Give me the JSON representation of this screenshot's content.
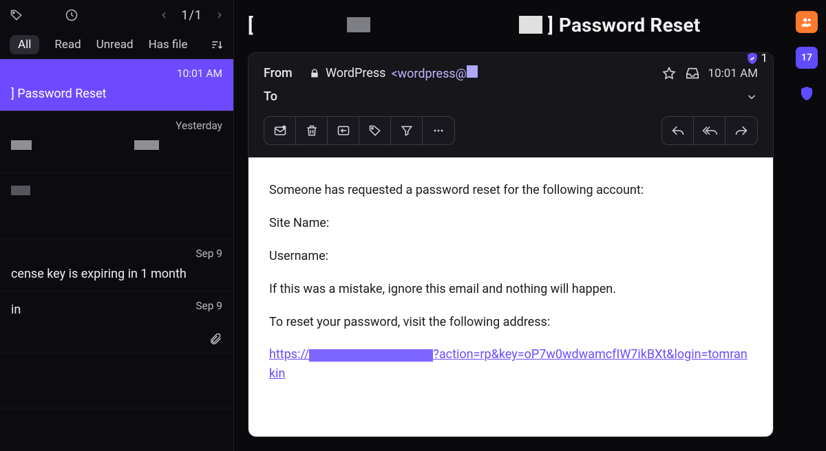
{
  "topbar": {
    "pager": "1/1"
  },
  "filters": {
    "all": "All",
    "read": "Read",
    "unread": "Unread",
    "hasfile": "Has file"
  },
  "messages": [
    {
      "date": "10:01 AM",
      "subject": "] Password Reset"
    },
    {
      "date": "Yesterday",
      "subject": ""
    },
    {
      "date": "",
      "subject": ""
    },
    {
      "date": "Sep 9",
      "subject": "cense key is expiring in 1 month"
    },
    {
      "date": "Sep 9",
      "subject": "in",
      "has_attachment": true
    }
  ],
  "mail": {
    "title": "Password Reset",
    "badge_count": "1",
    "from_label": "From",
    "from_name": "WordPress",
    "from_addr": "<wordpress@",
    "to_label": "To",
    "time": "10:01 AM",
    "body": {
      "p1": "Someone has requested a password reset for the following account:",
      "p2": "Site Name:",
      "p3": "Username:",
      "p4": "If this was a mistake, ignore this email and nothing will happen.",
      "p5": "To reset your password, visit the following address:",
      "link_prefix": "https://",
      "link_suffix": "?action=rp&key=oP7w0wdwamcfIW7ikBXt&login=tomrankin"
    }
  },
  "rail": {
    "calendar_day": "17"
  }
}
